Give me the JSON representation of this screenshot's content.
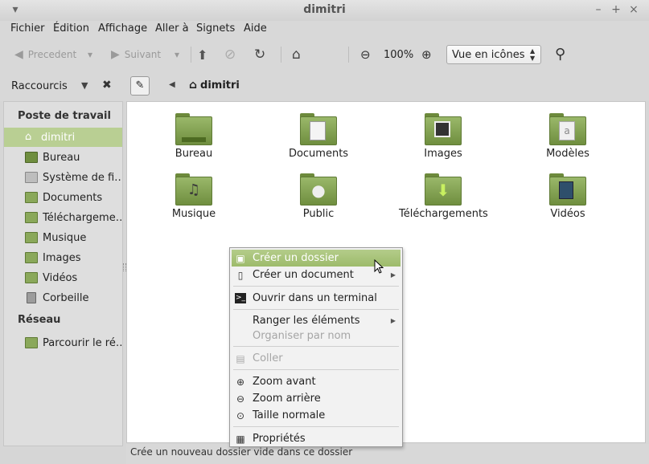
{
  "window": {
    "title": "dimitri"
  },
  "menubar": [
    "Fichier",
    "Édition",
    "Affichage",
    "Aller à",
    "Signets",
    "Aide"
  ],
  "toolbar": {
    "back_label": "Precedent",
    "forward_label": "Suivant",
    "zoom_value": "100%",
    "view_mode": "Vue en icônes"
  },
  "sidebar": {
    "header_label": "Raccourcis",
    "sections": [
      {
        "title": "Poste de travail",
        "items": [
          {
            "label": "dimitri",
            "icon": "home-icon",
            "selected": true
          },
          {
            "label": "Bureau",
            "icon": "desktop-icon"
          },
          {
            "label": "Système de fi…",
            "icon": "drive-icon"
          },
          {
            "label": "Documents",
            "icon": "folder-documents-icon"
          },
          {
            "label": "Téléchargeme…",
            "icon": "folder-download-icon"
          },
          {
            "label": "Musique",
            "icon": "folder-music-icon"
          },
          {
            "label": "Images",
            "icon": "folder-pictures-icon"
          },
          {
            "label": "Vidéos",
            "icon": "folder-videos-icon"
          },
          {
            "label": "Corbeille",
            "icon": "trash-icon"
          }
        ]
      },
      {
        "title": "Réseau",
        "items": [
          {
            "label": "Parcourir le ré…",
            "icon": "network-icon"
          }
        ]
      }
    ]
  },
  "pathbar": {
    "current": "dimitri"
  },
  "folders": [
    {
      "name": "Bureau",
      "icon": "desktop-folder-icon"
    },
    {
      "name": "Documents",
      "icon": "documents-folder-icon"
    },
    {
      "name": "Images",
      "icon": "pictures-folder-icon"
    },
    {
      "name": "Modèles",
      "icon": "templates-folder-icon"
    },
    {
      "name": "Musique",
      "icon": "music-folder-icon"
    },
    {
      "name": "Public",
      "icon": "public-folder-icon"
    },
    {
      "name": "Téléchargements",
      "icon": "download-folder-icon"
    },
    {
      "name": "Vidéos",
      "icon": "videos-folder-icon"
    }
  ],
  "context_menu": {
    "items": [
      {
        "label": "Créer un dossier",
        "icon": "new-folder-icon",
        "highlighted": true
      },
      {
        "label": "Créer un document",
        "icon": "new-document-icon",
        "submenu": true
      },
      {
        "label": "Ouvrir dans un terminal",
        "icon": "terminal-icon"
      },
      {
        "label": "Ranger les éléments",
        "submenu": true
      },
      {
        "label": "Organiser par nom",
        "disabled": true
      },
      {
        "label": "Coller",
        "icon": "paste-icon",
        "disabled": true
      },
      {
        "label": "Zoom avant",
        "icon": "zoom-in-icon"
      },
      {
        "label": "Zoom arrière",
        "icon": "zoom-out-icon"
      },
      {
        "label": "Taille normale",
        "icon": "zoom-normal-icon"
      },
      {
        "label": "Propriétés",
        "icon": "properties-icon"
      }
    ]
  },
  "statusbar": {
    "text": "Crée un nouveau dossier vide dans ce dossier"
  },
  "colors": {
    "accent": "#9dbb6b",
    "folder": "#8aa85a",
    "selected_sidebar": "#b9cf93"
  }
}
